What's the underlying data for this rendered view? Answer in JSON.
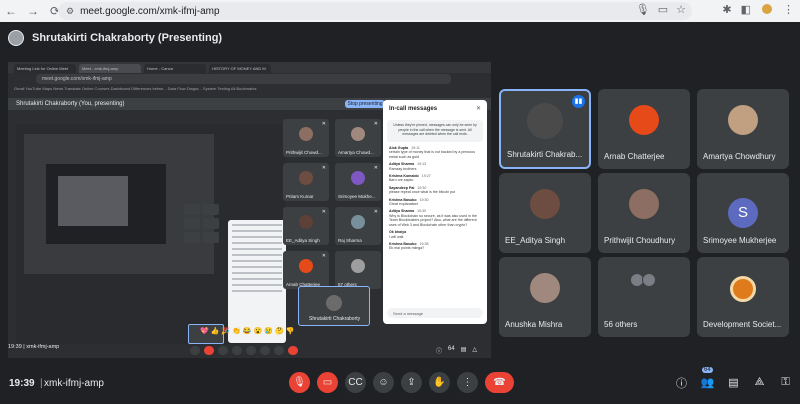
{
  "browser": {
    "url": "meet.google.com/xmk-ifmj-amp"
  },
  "presenting": {
    "title": "Shrutakirti Chakraborty (Presenting)"
  },
  "shared_screen": {
    "inner_tabs": [
      "Meeting Link for Online Meet",
      "Meet - xmk-ifmj-amp",
      "Home - Canva",
      "HISTORY OF MONEY AND M"
    ],
    "inner_url": "meet.google.com/xmk-ifmj-amp",
    "bookmarks": "Gmail  YouTube  Maps  News  Translate  Online Courses  Dashboard  Differences betwe...  Data Flow Diagra...  System Testing  All Bookmarks",
    "presenting_bar": "Shrutakirti Chakraborty (You, presenting)",
    "stop_label": "Stop presenting",
    "participants": [
      {
        "name": "Prithwijit Chowd...",
        "color": "#8d6e63"
      },
      {
        "name": "Amartya Chowd...",
        "color": "#a1887f"
      },
      {
        "name": "Pritam Kumar",
        "color": "#6d4c41"
      },
      {
        "name": "Srimoyee Mukhe...",
        "color": "#7e57c2"
      },
      {
        "name": "EE_Aditya Singh",
        "color": "#5d4037"
      },
      {
        "name": "Raj Sharma",
        "color": "#78909c"
      },
      {
        "name": "Arnab Chatterjee",
        "color": "#e64a19"
      },
      {
        "name": "57 others",
        "color": "#9e9e9e"
      }
    ],
    "self_tile": "Shrutakirti Chakraborty",
    "chat": {
      "title": "In-call messages",
      "note": "Unless they're pinned, messages can only be seen by people in the call when the message is sent. All messages are deleted when the call ends.",
      "messages": [
        {
          "author": "Alok Gupta",
          "time": "19:11",
          "text": "certain type of money that is not backed by a precious metal such as gold"
        },
        {
          "author": "Aditya Sharma",
          "time": "19:13",
          "text": "Ramzay brothers"
        },
        {
          "author": "Krishna Komaldo",
          "time": "19:27",
          "text": "Barn ore sapko"
        },
        {
          "author": "Sayandeep Pal",
          "time": "19:30",
          "text": "please repeat once what is the bitcoin put"
        },
        {
          "author": "Krishna Basubo",
          "time": "19:30",
          "text": "Great explanation!"
        },
        {
          "author": "Aditya Sharma",
          "time": "19:30",
          "text": "Why is Blockchain so secure, as it was also used in the Team Blockbusters project? Also, what are the different uses of Web 3 and Blockchain other than crypto?"
        },
        {
          "author": "Ok bhaiya",
          "time": "",
          "text": "I will wait"
        },
        {
          "author": "Krishna Basubo",
          "time": "19:38",
          "text": "Ek mai points milega?"
        }
      ],
      "send_placeholder": "Send a message"
    },
    "reactions": "💖👍🎉👏😂😮😢🤔👎",
    "footer": "19:39 | xmk-ifmj-amp",
    "count": "64"
  },
  "tiles": [
    {
      "label": "Shrutakirti Chakrab...",
      "color": "#4a4a4a",
      "type": "photo"
    },
    {
      "label": "Arnab Chatterjee",
      "color": "#e64a19",
      "type": "photo"
    },
    {
      "label": "Amartya Chowdhury",
      "color": "#c0a080",
      "type": "photo"
    },
    {
      "label": "EE_Aditya Singh",
      "color": "#6d4c41",
      "type": "photo"
    },
    {
      "label": "Prithwijit Choudhury",
      "color": "#8d6e63",
      "type": "photo"
    },
    {
      "label": "Srimoyee Mukherjee",
      "letter": "S",
      "type": "letter"
    },
    {
      "label": "Anushka Mishra",
      "color": "#a1887f",
      "type": "photo"
    },
    {
      "label": "56 others",
      "type": "others"
    },
    {
      "label": "Development Societ...",
      "type": "ring"
    }
  ],
  "bottom": {
    "time": "19:39",
    "meeting_code": "xmk-ifmj-amp",
    "people_count": "64"
  },
  "colors": {
    "background": "#202124",
    "tile": "#3c4043",
    "accent": "#8ab4f8",
    "danger": "#ea4335"
  }
}
